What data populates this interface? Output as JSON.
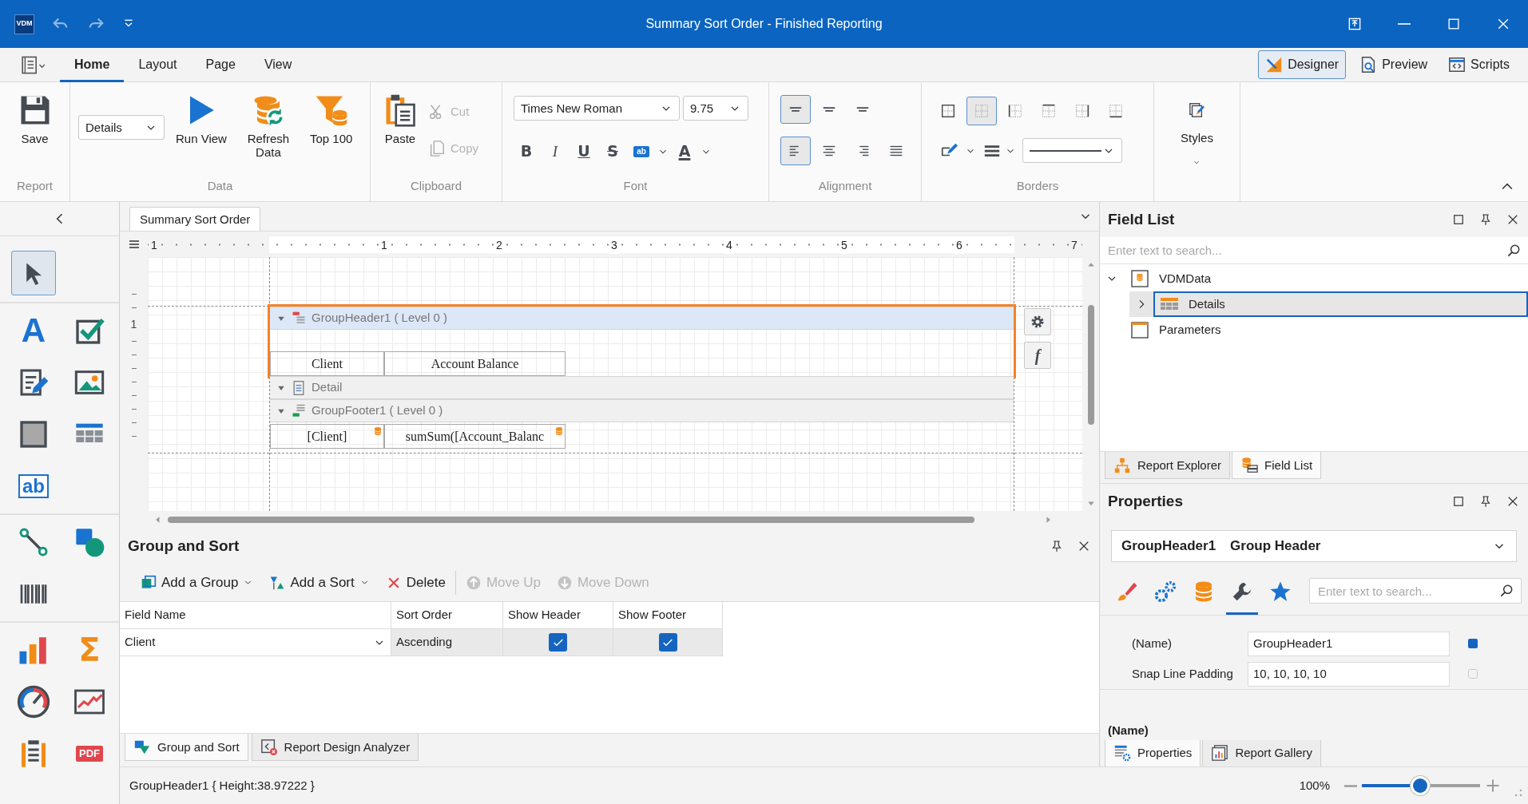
{
  "window": {
    "app_badge": "VDM",
    "title": "Summary Sort Order - Finished Reporting"
  },
  "ribbon": {
    "tabs": [
      {
        "label": "Home",
        "selected": true
      },
      {
        "label": "Layout",
        "selected": false
      },
      {
        "label": "Page",
        "selected": false
      },
      {
        "label": "View",
        "selected": false
      }
    ],
    "view_modes": [
      {
        "label": "Designer",
        "selected": true
      },
      {
        "label": "Preview",
        "selected": false
      },
      {
        "label": "Scripts",
        "selected": false
      }
    ],
    "groups": [
      {
        "kind": "report",
        "caption": "Report",
        "buttons": [
          {
            "label": "Save"
          }
        ]
      },
      {
        "kind": "data",
        "caption": "Data",
        "combo": {
          "value": "Details"
        },
        "buttons": [
          {
            "label": "Run View"
          },
          {
            "label": "Refresh Data"
          },
          {
            "label": "Top 100"
          }
        ]
      },
      {
        "kind": "clipboard",
        "caption": "Clipboard",
        "buttons": [
          {
            "label": "Paste",
            "disabled": false
          },
          {
            "label": "Cut",
            "disabled": true
          },
          {
            "label": "Copy",
            "disabled": true
          }
        ]
      },
      {
        "kind": "font",
        "caption": "Font",
        "font_name": "Times New Roman",
        "font_size": "9.75",
        "format_buttons": [
          {
            "glyph": "B"
          },
          {
            "glyph": "I"
          },
          {
            "glyph": "U"
          },
          {
            "glyph": "S"
          }
        ],
        "highlight_glyph": "ab",
        "font_color_glyph": "A"
      },
      {
        "kind": "alignment",
        "caption": "Alignment",
        "vertical": [
          {
            "selected": true
          },
          {
            "selected": false
          },
          {
            "selected": false
          }
        ],
        "horizontal": [
          {
            "selected": true
          },
          {
            "selected": false
          },
          {
            "selected": false
          },
          {
            "selected": false
          }
        ]
      },
      {
        "kind": "borders",
        "caption": "Borders",
        "borders": [
          {
            "selected": false
          },
          {
            "selected": true
          },
          {
            "selected": false
          },
          {
            "selected": false
          },
          {
            "selected": false
          },
          {
            "selected": false
          }
        ]
      },
      {
        "kind": "styles",
        "label": "Styles"
      }
    ]
  },
  "toolbox": {
    "groups": [
      {
        "items": [
          {
            "kind": "pointer",
            "selected": true
          }
        ]
      },
      {
        "items": [
          {
            "kind": "label",
            "glyph": "A",
            "selected": false
          },
          {
            "kind": "checkbox",
            "selected": false
          },
          {
            "kind": "rich-text",
            "selected": false
          },
          {
            "kind": "picture",
            "selected": false
          },
          {
            "kind": "panel",
            "selected": false
          },
          {
            "kind": "table",
            "selected": false
          },
          {
            "kind": "text-box",
            "glyph": "ab",
            "selected": false
          }
        ]
      },
      {
        "items": [
          {
            "kind": "line",
            "selected": false
          },
          {
            "kind": "shape",
            "selected": false
          },
          {
            "kind": "barcode",
            "selected": false
          }
        ]
      },
      {
        "items": [
          {
            "kind": "chart",
            "selected": false
          },
          {
            "kind": "summary",
            "glyph": "Σ",
            "selected": false
          },
          {
            "kind": "gauge",
            "selected": false
          },
          {
            "kind": "sparkline",
            "selected": false
          },
          {
            "kind": "contents",
            "selected": false
          },
          {
            "kind": "pdf",
            "glyph": "PDF",
            "selected": false
          }
        ]
      }
    ]
  },
  "document_tabs": [
    {
      "label": "Summary Sort Order",
      "selected": true
    }
  ],
  "ruler": {
    "labels": [
      "1",
      "1",
      "2",
      "3",
      "4",
      "5",
      "6",
      "7"
    ]
  },
  "vertical_ruler": {
    "labels": [
      "1"
    ]
  },
  "bands": [
    {
      "kind": "group-header",
      "caption": "GroupHeader1 ( Level 0 )",
      "expanded": true,
      "selected": true,
      "cells": [
        {
          "text": "Client",
          "bound": false
        },
        {
          "text": "Account Balance",
          "bound": false
        }
      ]
    },
    {
      "kind": "detail",
      "caption": "Detail",
      "expanded": true,
      "selected": false
    },
    {
      "kind": "group-footer",
      "caption": "GroupFooter1 ( Level 0 )",
      "expanded": true,
      "selected": false,
      "cells": [
        {
          "text": "[Client]",
          "bound": true
        },
        {
          "text": "sumSum([Account_Balanc",
          "bound": true
        }
      ]
    }
  ],
  "smart_tags": {
    "function_glyph": "f"
  },
  "group_and_sort": {
    "title": "Group and Sort",
    "toolbar": [
      {
        "label": "Add a Group",
        "dropdown": true,
        "disabled": false
      },
      {
        "label": "Add a Sort",
        "dropdown": true,
        "disabled": false
      },
      {
        "label": "Delete",
        "dropdown": false,
        "disabled": false
      },
      {
        "label": "Move Up",
        "dropdown": false,
        "disabled": true
      },
      {
        "label": "Move Down",
        "dropdown": false,
        "disabled": true
      }
    ],
    "columns": [
      "Field Name",
      "Sort Order",
      "Show Header",
      "Show Footer"
    ],
    "rows": [
      {
        "field_name": "Client",
        "sort_order": "Ascending",
        "show_header": true,
        "show_footer": true
      }
    ],
    "tabs": [
      {
        "label": "Group and Sort",
        "selected": true
      },
      {
        "label": "Report Design Analyzer",
        "selected": false
      }
    ]
  },
  "status_bar": {
    "text": "GroupHeader1 { Height:38.97222 }",
    "zoom": "100%",
    "zoom_slider": {
      "level": 0.49
    }
  },
  "field_list": {
    "title": "Field List",
    "search": {
      "placeholder": "Enter text to search..."
    },
    "tree": [
      {
        "label": "VDMData",
        "kind": "datasource",
        "expanded": true,
        "selected": false,
        "children": [
          {
            "label": "Details",
            "kind": "table",
            "expanded": false,
            "selected": true
          }
        ]
      },
      {
        "label": "Parameters",
        "kind": "parameters",
        "selected": false
      }
    ],
    "tabs": [
      {
        "label": "Report Explorer",
        "selected": false
      },
      {
        "label": "Field List",
        "selected": true
      }
    ]
  },
  "properties": {
    "title": "Properties",
    "object": {
      "name": "GroupHeader1",
      "type": "Group Header"
    },
    "category_tabs": [
      {
        "selected": false
      },
      {
        "selected": false
      },
      {
        "selected": false
      },
      {
        "selected": true
      },
      {
        "selected": false
      }
    ],
    "search": {
      "placeholder": "Enter text to search..."
    },
    "rows": [
      {
        "label": "(Name)",
        "value": "GroupHeader1",
        "set": true
      },
      {
        "label": "Snap Line Padding",
        "value": "10, 10, 10, 10",
        "set": false
      }
    ],
    "description": "(Name)",
    "tabs": [
      {
        "label": "Properties",
        "selected": true
      },
      {
        "label": "Report Gallery",
        "selected": false
      }
    ]
  }
}
